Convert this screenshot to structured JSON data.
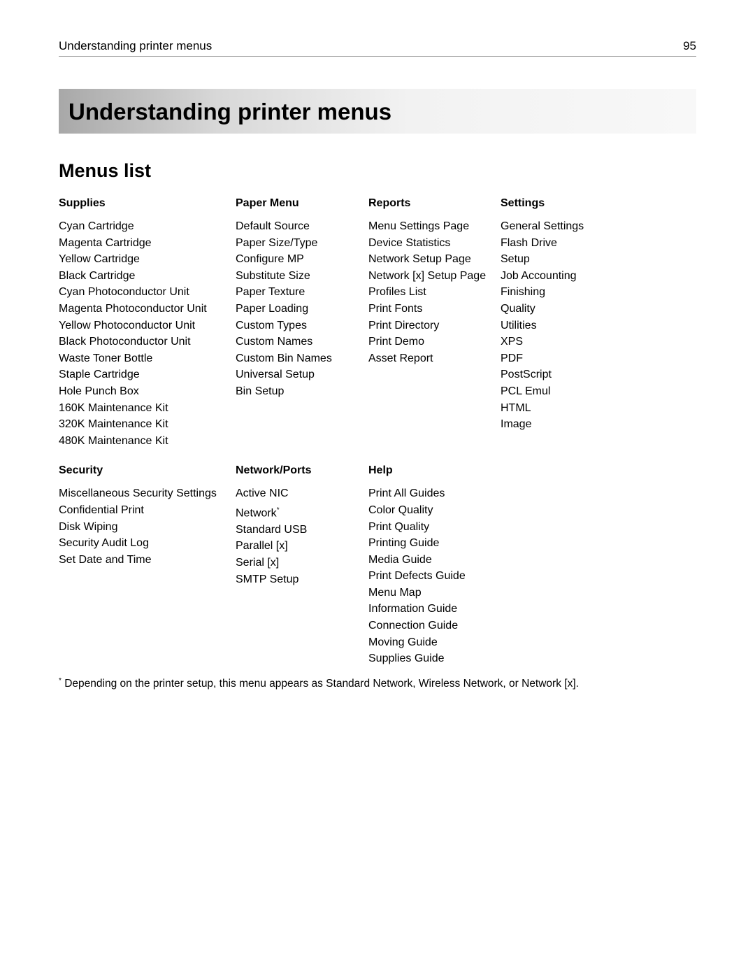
{
  "header": {
    "running_head": "Understanding printer menus",
    "page_number": "95"
  },
  "chapter_title": "Understanding printer menus",
  "section_title": "Menus list",
  "menus_row1": {
    "col1": {
      "head": "Supplies",
      "items": [
        "Cyan Cartridge",
        "Magenta Cartridge",
        "Yellow Cartridge",
        "Black Cartridge",
        "Cyan Photoconductor Unit",
        "Magenta Photoconductor Unit",
        "Yellow Photoconductor Unit",
        "Black Photoconductor Unit",
        "Waste Toner Bottle",
        "Staple Cartridge",
        "Hole Punch Box",
        "160K Maintenance Kit",
        "320K Maintenance Kit",
        "480K Maintenance Kit"
      ]
    },
    "col2": {
      "head": "Paper Menu",
      "items": [
        "Default Source",
        "Paper Size/Type",
        "Configure MP",
        "Substitute Size",
        "Paper Texture",
        "Paper Loading",
        "Custom Types",
        "Custom Names",
        "Custom Bin Names",
        "Universal Setup",
        "Bin Setup"
      ]
    },
    "col3": {
      "head": "Reports",
      "items": [
        "Menu Settings Page",
        "Device Statistics",
        "Network Setup Page",
        "Network [x] Setup Page",
        "Profiles List",
        "Print Fonts",
        "Print Directory",
        "Print Demo",
        "Asset Report"
      ]
    },
    "col4": {
      "head": "Settings",
      "items": [
        "General Settings",
        "Flash Drive",
        "Setup",
        "Job Accounting",
        "Finishing",
        "Quality",
        "Utilities",
        "XPS",
        "PDF",
        "PostScript",
        "PCL Emul",
        "HTML",
        "Image"
      ]
    }
  },
  "menus_row2": {
    "col1": {
      "head": "Security",
      "items": [
        "Miscellaneous Security Settings",
        "Confidential Print",
        "Disk Wiping",
        "Security Audit Log",
        "Set Date and Time"
      ]
    },
    "col2": {
      "head": "Network/Ports",
      "items_complex": [
        {
          "text": "Active NIC",
          "sup": ""
        },
        {
          "text": "Network",
          "sup": "*"
        },
        {
          "text": "Standard USB",
          "sup": ""
        },
        {
          "text": "Parallel [x]",
          "sup": ""
        },
        {
          "text": "Serial [x]",
          "sup": ""
        },
        {
          "text": "SMTP Setup",
          "sup": ""
        }
      ]
    },
    "col3": {
      "head": "Help",
      "items": [
        "Print All Guides",
        "Color Quality",
        "Print Quality",
        "Printing Guide",
        "Media Guide",
        "Print Defects Guide",
        "Menu Map",
        "Information Guide",
        "Connection Guide",
        "Moving Guide",
        "Supplies Guide"
      ]
    }
  },
  "footnote": {
    "marker": "*",
    "text": " Depending on the printer setup, this menu appears as Standard Network, Wireless Network, or Network [x]."
  }
}
